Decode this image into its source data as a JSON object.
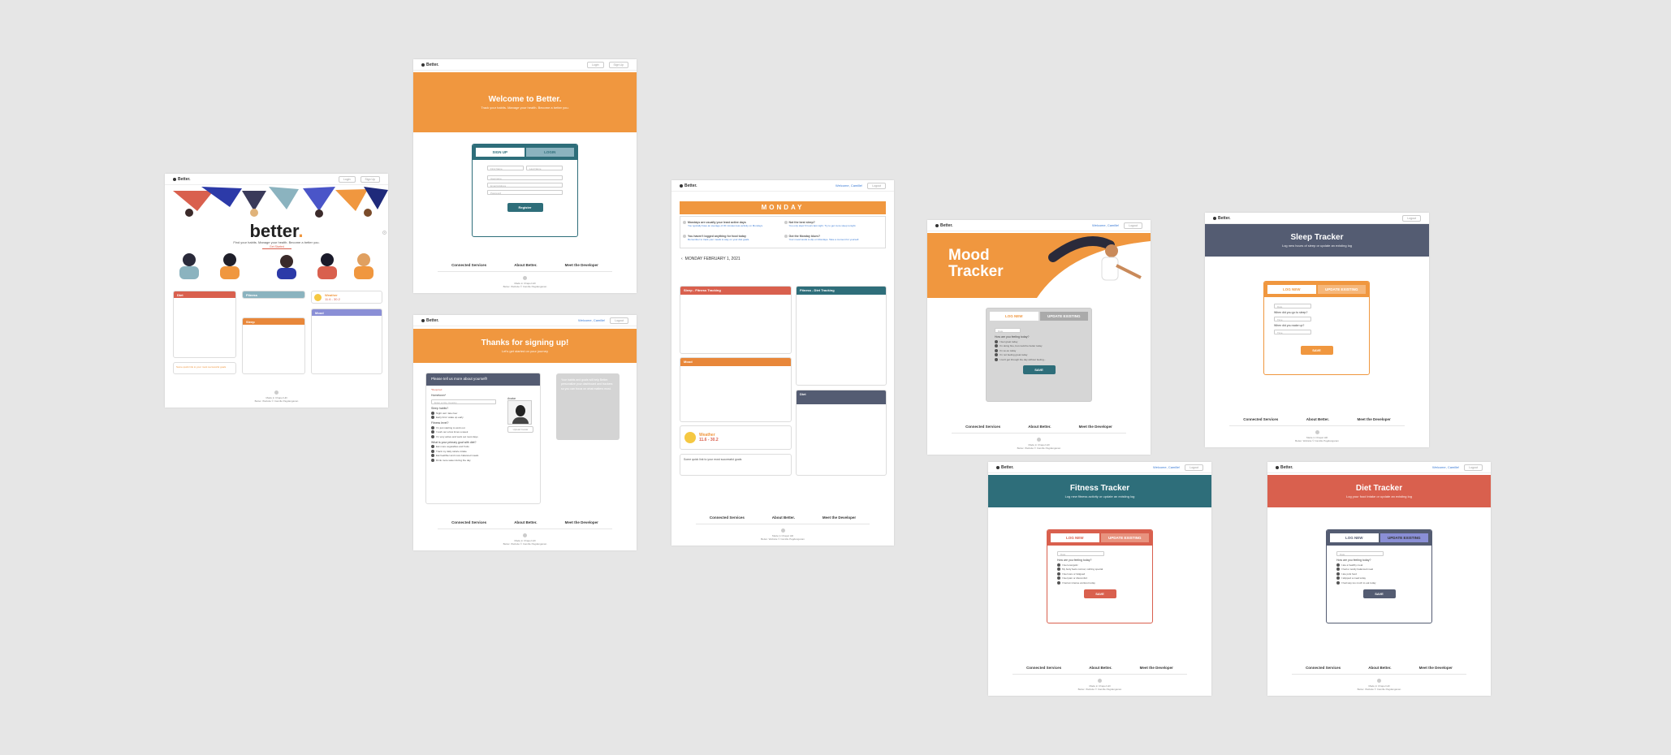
{
  "brand": "Better.",
  "nav": {
    "login": "Login",
    "signup": "Sign Up",
    "logout": "Logout",
    "welcome": "Welcome, Camille!"
  },
  "footer": {
    "links": [
      "Connected Services",
      "About Better.",
      "Meet the Developer"
    ],
    "line1": "Made in Chapel Hill",
    "line2": "Better. Website © Camille Pagdanganan"
  },
  "landing": {
    "wordmark": "better",
    "tagline": "Find your habits. Manage your health. Become a better you.",
    "cta": "Get Started",
    "cards": {
      "sleep": "Sleep",
      "fitness": "Fitness",
      "mood": "Mood",
      "diet": "Diet"
    },
    "weather": {
      "label": "Weather",
      "range": "11.6 - 30.2"
    },
    "note": "Some quick link to your most successful goals"
  },
  "welcome": {
    "title": "Welcome to Better.",
    "subtitle": "Track your habits. Manage your health. Become a better you.",
    "tab_signup": "SIGN UP",
    "tab_login": "LOGIN",
    "fields": [
      "First Name",
      "Last Name",
      "Username",
      "Email Address",
      "Password"
    ],
    "register": "Register"
  },
  "thanks": {
    "title": "Thanks for signing up!",
    "subtitle": "Let's get started on your journey",
    "form_header": "Please tell us more about yourself!",
    "required": "*Required",
    "q_hometown": "Hometown*",
    "hometown_placeholder": "Enter a City, Country",
    "q_avatar": "Avatar",
    "avatar_btn": "Upload Avatar",
    "q_sleep": "Sleep habits?",
    "sleep_opts": [
      "Night owl / late riser",
      "Early bird / wake up early"
    ],
    "q_fitness": "Fitness level?",
    "fitness_opts": [
      "I'm just starting to work out",
      "I work out a few times a week",
      "I'm very active and work out most days"
    ],
    "q_diet": "What is your primary goal with diet?",
    "diet_opts": [
      "Eat more vegetables and fruits",
      "Track my daily calorie intake",
      "Eat healthier and more balanced meals",
      "Drink more water during the day"
    ],
    "side_text": "Your habits and goals will help Better. personalize your dashboard and trackers so you can focus on what matters most."
  },
  "dashboard": {
    "day": "MONDAY",
    "insights": [
      {
        "title": "Mondays are usually your least active days",
        "body": "You typically have an average of 30 minutes less activity on Mondays."
      },
      {
        "title": "Not the best sleep?",
        "body": "You only slept 6 hours last night. Try to get more sleep tonight."
      },
      {
        "title": "You haven't logged anything for food today",
        "body": "Remember to track your meals to stay on your diet goals."
      },
      {
        "title": "Got the Monday blues?",
        "body": "Your mood tends to dip on Mondays. Take a moment for yourself."
      }
    ],
    "date": "MONDAY FEBRUARY 1, 2021",
    "sleep_card": "Sleep - Fitness Tracking",
    "fitness_card": "Fitness - Diet Tracking",
    "mood_card": "Mood",
    "diet_card": "Diet",
    "weather": {
      "label": "Weather",
      "range": "11.6 - 30.2"
    },
    "note": "Some quick link to your most successful goals"
  },
  "mood": {
    "title": "Mood Tracker",
    "tab_log": "LOG NEW",
    "tab_update": "UPDATE EXISTING",
    "date_ph": "Date",
    "question": "How are you feeling today?",
    "options": [
      "I feel great today",
      "I'm doing fine, but could be better today",
      "I'm so-so today",
      "I'm not feeling great today",
      "I can't get through the day without feeling..."
    ],
    "save": "SAVE"
  },
  "sleep": {
    "title": "Sleep Tracker",
    "subtitle": "Log new hours of sleep or update an existing log",
    "tab_log": "LOG NEW",
    "tab_update": "UPDATE EXISTING",
    "date_ph": "Date",
    "q1": "When did you go to sleep?",
    "q2": "When did you wake up?",
    "time_ph": "Time",
    "save": "SAVE"
  },
  "fitness": {
    "title": "Fitness Tracker",
    "subtitle": "Log new fitness activity or update an existing log",
    "tab_log": "LOG NEW",
    "tab_update": "UPDATE EXISTING",
    "date_ph": "Date",
    "question": "How are you feeling today?",
    "options": [
      "I feel energetic",
      "My body feels normal, nothing special",
      "I feel sore or fatigued",
      "I feel pain or discomfort",
      "I had an intense workout today"
    ],
    "save": "SAVE"
  },
  "diet": {
    "title": "Diet Tracker",
    "subtitle": "Log your food intake or update an existing log",
    "tab_log": "LOG NEW",
    "tab_update": "UPDATE EXISTING",
    "date_ph": "Date",
    "question": "How are you feeling today?",
    "options": [
      "I ate a healthy meal",
      "I had a mostly balanced meal",
      "I ate junk food",
      "I skipped a meal today",
      "I had way too much to eat today"
    ],
    "save": "SAVE"
  },
  "colors": {
    "orange": "#f0973f",
    "teal": "#2e6e7a",
    "coral": "#d9604e",
    "slate": "#545c72",
    "sage": "#8bb3bf",
    "purple": "#8a8fd6",
    "dash_orange": "#e8873a"
  }
}
